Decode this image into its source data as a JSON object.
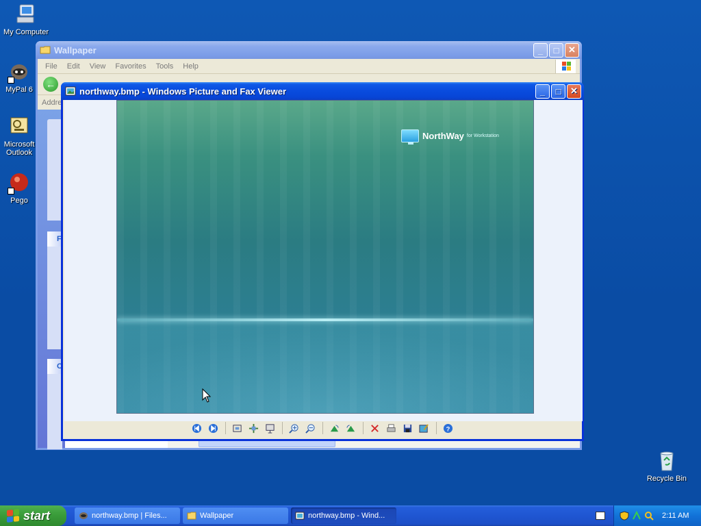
{
  "desktop": {
    "icons": [
      {
        "label": "My Computer"
      },
      {
        "label": "MyPal 6"
      },
      {
        "label": "Microsoft Outlook"
      },
      {
        "label": "Pego"
      },
      {
        "label": "Recycle Bin"
      }
    ]
  },
  "explorer": {
    "title": "Wallpaper",
    "menu": [
      "File",
      "Edit",
      "View",
      "Favorites",
      "Tools",
      "Help"
    ],
    "address_label": "Address",
    "task_headers": [
      "File",
      "Other"
    ]
  },
  "viewer": {
    "title": "northway.bmp - Windows Picture and Fax Viewer",
    "image": {
      "brand_name": "NorthWay",
      "brand_sub": "for Workstation"
    },
    "toolbar": [
      "previous-image",
      "next-image",
      "best-fit",
      "actual-size",
      "slideshow",
      "zoom-in",
      "zoom-out",
      "rotate-clockwise",
      "rotate-counterclockwise",
      "delete",
      "print",
      "copy-to",
      "open-for-editing",
      "help"
    ]
  },
  "taskbar": {
    "start_label": "start",
    "tasks": [
      {
        "label": "northway.bmp | Files...",
        "active": false
      },
      {
        "label": "Wallpaper",
        "active": false
      },
      {
        "label": "northway.bmp - Wind...",
        "active": true
      }
    ],
    "clock": "2:11 AM"
  },
  "colors": {
    "desktop": "#0a4ca4",
    "title_active": "#0a4ee0",
    "taskbar": "#1f56d2",
    "start_green": "#3a9c3a"
  }
}
